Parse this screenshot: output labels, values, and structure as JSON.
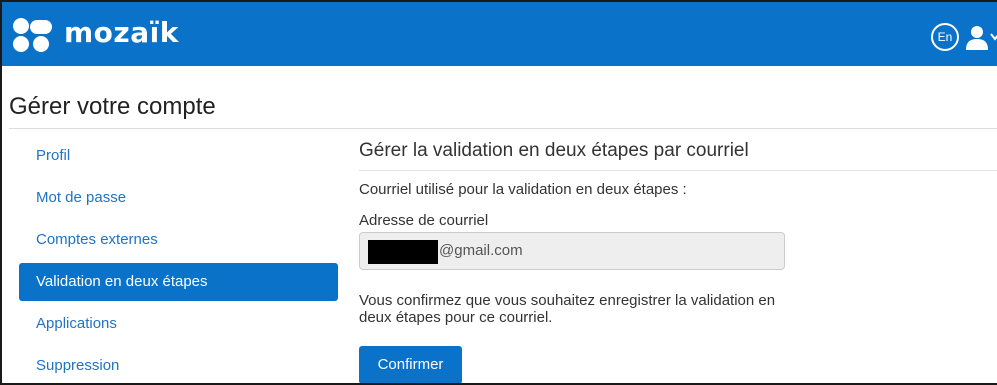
{
  "header": {
    "brand": "mozaïk",
    "lang_button": "En",
    "icons": [
      "mozaik-logo-icon",
      "user-icon",
      "chevron-down-icon"
    ],
    "bg_color": "#0b72c9"
  },
  "page": {
    "title": "Gérer votre compte"
  },
  "sidebar": {
    "items": [
      {
        "label": "Profil",
        "active": false
      },
      {
        "label": "Mot de passe",
        "active": false
      },
      {
        "label": "Comptes externes",
        "active": false
      },
      {
        "label": "Validation en deux étapes",
        "active": true
      },
      {
        "label": "Applications",
        "active": false
      },
      {
        "label": "Suppression",
        "active": false
      }
    ]
  },
  "main": {
    "section_title": "Gérer la validation en deux étapes par courriel",
    "description": "Courriel utilisé pour la validation en deux étapes :",
    "email_label": "Adresse de courriel",
    "email_value": "@gmail.com",
    "confirm_text": "Vous confirmez que vous souhaitez enregistrer la validation en deux étapes pour ce courriel.",
    "confirm_button": "Confirmer"
  }
}
